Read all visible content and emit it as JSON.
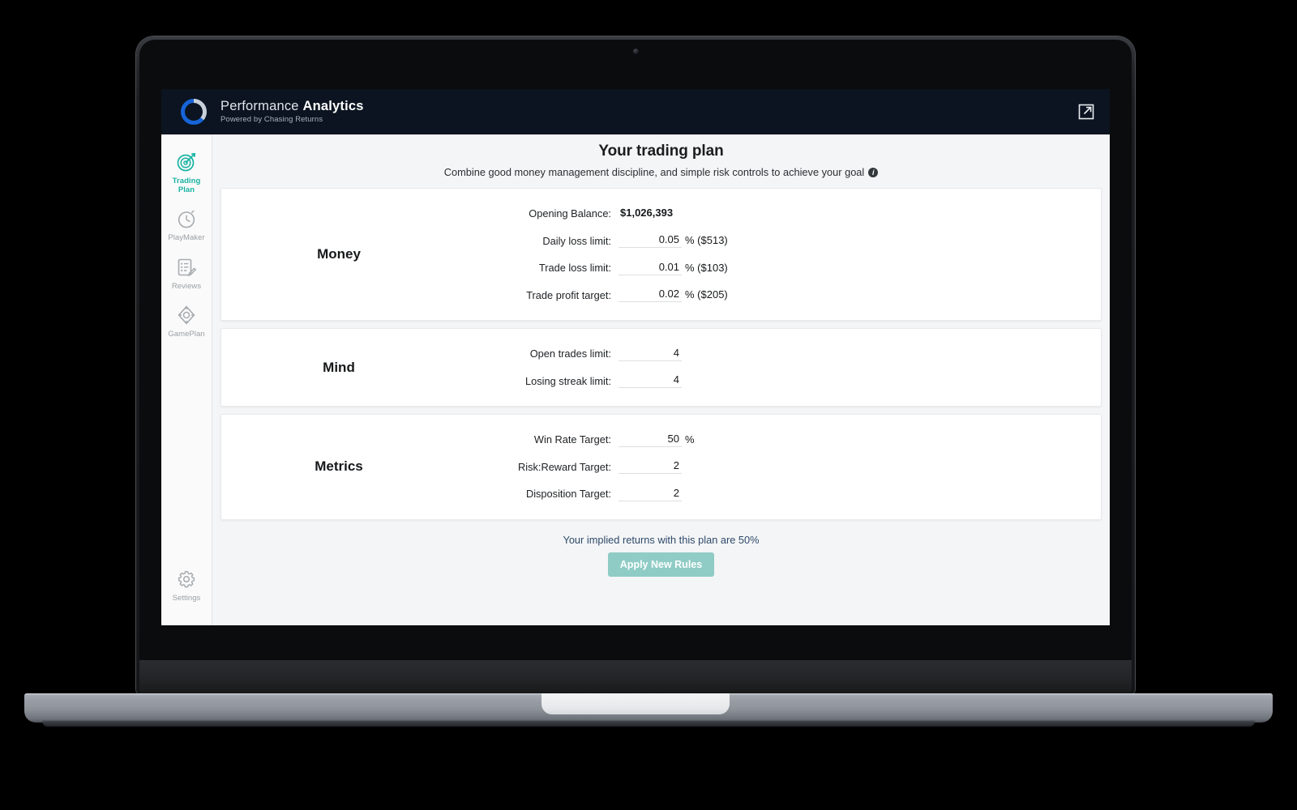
{
  "header": {
    "brand_title_light": "Performance ",
    "brand_title_bold": "Analytics",
    "brand_subtitle": "Powered by Chasing Returns",
    "logo_icon": "circular-progress-ring-logo",
    "external_link_icon": "external-link-icon"
  },
  "sidebar": {
    "items": [
      {
        "label": "Trading\nPlan",
        "label_line1": "Trading",
        "label_line2": "Plan",
        "icon": "target-dart-icon",
        "active": true
      },
      {
        "label": "PlayMaker",
        "icon": "stopwatch-icon",
        "active": false
      },
      {
        "label": "Reviews",
        "icon": "clipboard-pencil-icon",
        "active": false
      },
      {
        "label": "GamePlan",
        "icon": "compass-icon",
        "active": false
      }
    ],
    "settings": {
      "label": "Settings",
      "icon": "gear-icon"
    }
  },
  "page": {
    "title": "Your trading plan",
    "subtitle": "Combine good money management discipline, and simple risk controls to achieve your goal",
    "info_icon": "info-icon"
  },
  "sections": [
    {
      "label": "Money",
      "rows": [
        {
          "label": "Opening Balance:",
          "value": "$1,026,393",
          "suffix": "",
          "readonly": true
        },
        {
          "label": "Daily loss limit:",
          "value": "0.05",
          "suffix": "% ($513)",
          "readonly": false
        },
        {
          "label": "Trade loss limit:",
          "value": "0.01",
          "suffix": "% ($103)",
          "readonly": false
        },
        {
          "label": "Trade profit target:",
          "value": "0.02",
          "suffix": "% ($205)",
          "readonly": false
        }
      ]
    },
    {
      "label": "Mind",
      "rows": [
        {
          "label": "Open trades limit:",
          "value": "4",
          "suffix": "",
          "readonly": false
        },
        {
          "label": "Losing streak limit:",
          "value": "4",
          "suffix": "",
          "readonly": false
        }
      ]
    },
    {
      "label": "Metrics",
      "rows": [
        {
          "label": "Win Rate Target:",
          "value": "50",
          "suffix": "%",
          "readonly": false
        },
        {
          "label": "Risk:Reward Target:",
          "value": "2",
          "suffix": "",
          "readonly": false
        },
        {
          "label": "Disposition Target:",
          "value": "2",
          "suffix": "",
          "readonly": false
        }
      ]
    }
  ],
  "footer": {
    "implied_returns": "Your implied returns with this plan are 50%",
    "apply_label": "Apply New Rules"
  },
  "colors": {
    "accent_teal": "#17b3a3",
    "button_teal": "#8fccc5",
    "topbar_navy": "#0b1420",
    "logo_blue": "#1664d8",
    "implied_text": "#2e4a6b"
  }
}
